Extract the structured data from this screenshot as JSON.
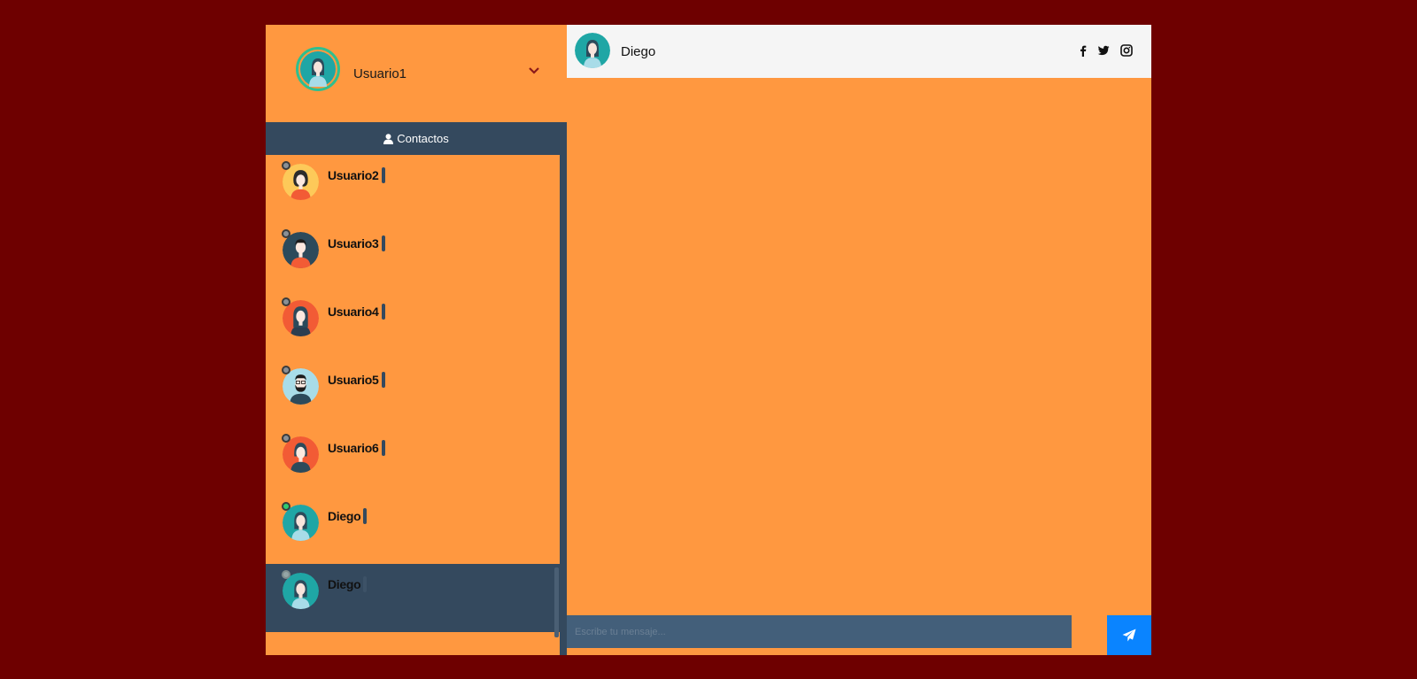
{
  "profile": {
    "name": "Usuario1",
    "avatar": "avatar-teal-woman"
  },
  "contacts_header": {
    "icon": "user-icon",
    "label": "Contactos"
  },
  "contacts": [
    {
      "name": "Usuario2",
      "avatar": "avatar-yellow-woman",
      "status": "offline"
    },
    {
      "name": "Usuario3",
      "avatar": "avatar-dark-man",
      "status": "offline"
    },
    {
      "name": "Usuario4",
      "avatar": "avatar-red-woman",
      "status": "offline"
    },
    {
      "name": "Usuario5",
      "avatar": "avatar-beard-man",
      "status": "offline"
    },
    {
      "name": "Usuario6",
      "avatar": "avatar-red-woman-2",
      "status": "offline"
    },
    {
      "name": "Diego",
      "avatar": "avatar-teal-woman",
      "status": "online"
    },
    {
      "name": "Diego",
      "avatar": "avatar-teal-woman",
      "status": "offline",
      "active": true
    }
  ],
  "chat": {
    "contact_name": "Diego",
    "social_icons": [
      "facebook-icon",
      "twitter-icon",
      "instagram-icon"
    ],
    "message_placeholder": "Escribe tu mensaje...",
    "send_icon": "paper-plane-icon"
  },
  "colors": {
    "background": "#6e0000",
    "panel": "#ff9840",
    "sidebar_dark": "#34495e",
    "input": "#435f7a",
    "send_button": "#0a84ff",
    "online": "#2ecc71"
  }
}
